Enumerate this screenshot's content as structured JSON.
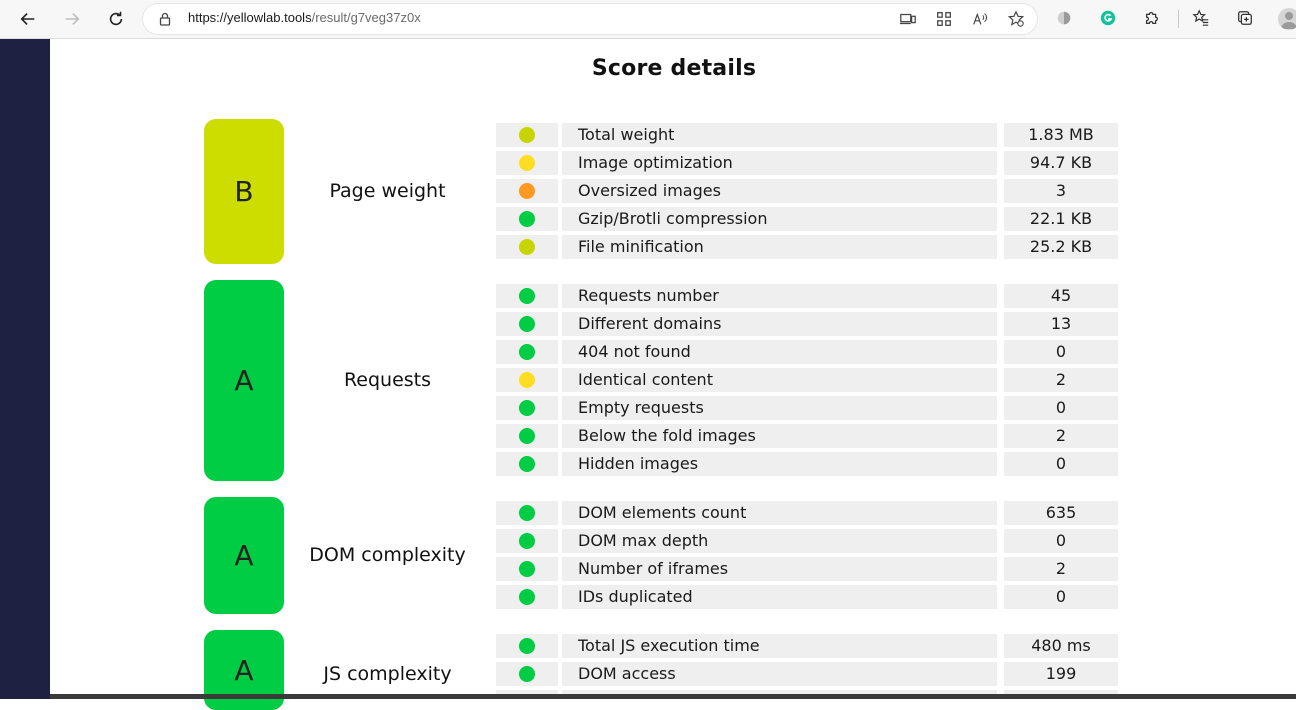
{
  "browser": {
    "url_host": "https://yellowlab.tools",
    "url_path": "/result/g7veg37z0x"
  },
  "page": {
    "title": "Score details"
  },
  "colors": {
    "green": "#00cc44",
    "yellowgreen": "#cddd00",
    "yellow": "#ffdd22",
    "orange": "#ff9922",
    "sidebar": "#1f2142"
  },
  "categories": [
    {
      "grade": "B",
      "name": "Page weight",
      "color": "#cddd00",
      "rules": [
        {
          "name": "Total weight",
          "value": "1.83 MB",
          "status": "#c8d400"
        },
        {
          "name": "Image optimization",
          "value": "94.7 KB",
          "status": "#ffdd22"
        },
        {
          "name": "Oversized images",
          "value": "3",
          "status": "#ff9922"
        },
        {
          "name": "Gzip/Brotli compression",
          "value": "22.1 KB",
          "status": "#00cc44"
        },
        {
          "name": "File minification",
          "value": "25.2 KB",
          "status": "#c8d400"
        }
      ]
    },
    {
      "grade": "A",
      "name": "Requests",
      "color": "#00cc44",
      "rules": [
        {
          "name": "Requests number",
          "value": "45",
          "status": "#00cc44"
        },
        {
          "name": "Different domains",
          "value": "13",
          "status": "#00cc44"
        },
        {
          "name": "404 not found",
          "value": "0",
          "status": "#00cc44"
        },
        {
          "name": "Identical content",
          "value": "2",
          "status": "#ffdd22"
        },
        {
          "name": "Empty requests",
          "value": "0",
          "status": "#00cc44"
        },
        {
          "name": "Below the fold images",
          "value": "2",
          "status": "#00cc44"
        },
        {
          "name": "Hidden images",
          "value": "0",
          "status": "#00cc44"
        }
      ]
    },
    {
      "grade": "A",
      "name": "DOM complexity",
      "color": "#00cc44",
      "rules": [
        {
          "name": "DOM elements count",
          "value": "635",
          "status": "#00cc44"
        },
        {
          "name": "DOM max depth",
          "value": "0",
          "status": "#00cc44"
        },
        {
          "name": "Number of iframes",
          "value": "2",
          "status": "#00cc44"
        },
        {
          "name": "IDs duplicated",
          "value": "0",
          "status": "#00cc44"
        }
      ]
    },
    {
      "grade": "A",
      "name": "JS complexity",
      "color": "#00cc44",
      "rules": [
        {
          "name": "Total JS execution time",
          "value": "480 ms",
          "status": "#00cc44"
        },
        {
          "name": "DOM access",
          "value": "199",
          "status": "#00cc44"
        }
      ]
    }
  ]
}
